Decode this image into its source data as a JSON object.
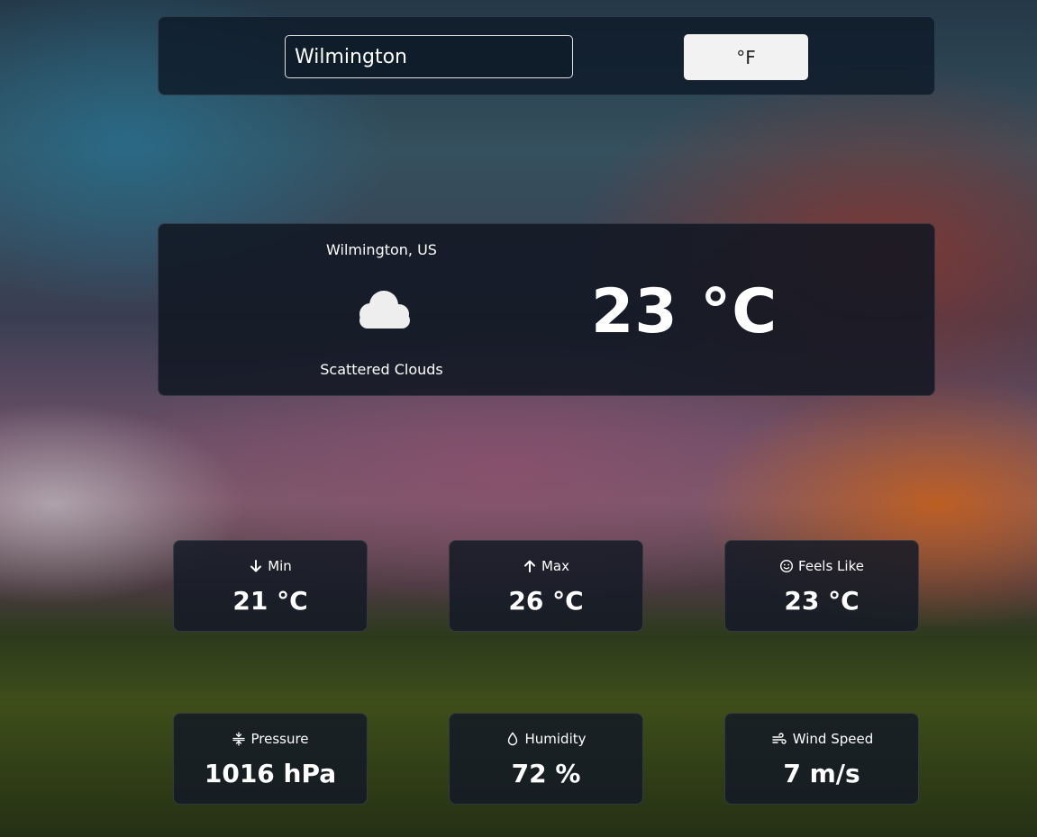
{
  "search": {
    "value": "Wilmington"
  },
  "unit_toggle": {
    "label": "°F"
  },
  "current": {
    "location": "Wilmington, US",
    "description": "Scattered Clouds",
    "temperature": "23 °C",
    "icon": "cloud-icon"
  },
  "stats": {
    "min": {
      "label": "Min",
      "value": "21 °C",
      "icon": "arrow-down-icon"
    },
    "max": {
      "label": "Max",
      "value": "26 °C",
      "icon": "arrow-up-icon"
    },
    "feels_like": {
      "label": "Feels Like",
      "value": "23 °C",
      "icon": "smile-icon"
    },
    "pressure": {
      "label": "Pressure",
      "value": "1016 hPa",
      "icon": "pressure-icon"
    },
    "humidity": {
      "label": "Humidity",
      "value": "72 %",
      "icon": "droplet-icon"
    },
    "wind": {
      "label": "Wind Speed",
      "value": "7 m/s",
      "icon": "wind-icon"
    }
  }
}
